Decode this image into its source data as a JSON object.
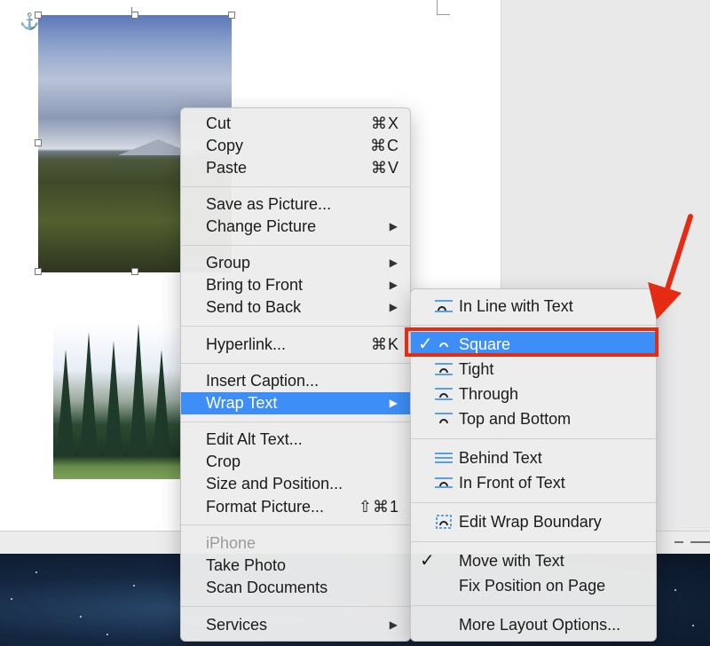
{
  "main_menu": {
    "items": [
      {
        "label": "Cut",
        "shortcut": "⌘X"
      },
      {
        "label": "Copy",
        "shortcut": "⌘C"
      },
      {
        "label": "Paste",
        "shortcut": "⌘V"
      },
      {
        "label": "Save as Picture..."
      },
      {
        "label": "Change Picture",
        "submenu": "▶"
      },
      {
        "label": "Group",
        "submenu": "▶"
      },
      {
        "label": "Bring to Front",
        "submenu": "▶"
      },
      {
        "label": "Send to Back",
        "submenu": "▶"
      },
      {
        "label": "Hyperlink...",
        "shortcut": "⌘K"
      },
      {
        "label": "Insert Caption..."
      },
      {
        "label": "Wrap Text",
        "submenu": "▶",
        "highlighted": true
      },
      {
        "label": "Edit Alt Text..."
      },
      {
        "label": "Crop"
      },
      {
        "label": "Size and Position..."
      },
      {
        "label": "Format Picture...",
        "shortcut": "⇧⌘1"
      },
      {
        "label": "iPhone",
        "disabled": true
      },
      {
        "label": "Take Photo"
      },
      {
        "label": "Scan Documents"
      },
      {
        "label": "Services",
        "submenu": "▶"
      }
    ]
  },
  "wrap_menu": {
    "items": [
      {
        "label": "In Line with Text"
      },
      {
        "label": "Square",
        "checked": true,
        "check": "✓"
      },
      {
        "label": "Tight"
      },
      {
        "label": "Through"
      },
      {
        "label": "Top and Bottom"
      },
      {
        "label": "Behind Text"
      },
      {
        "label": "In Front of Text"
      },
      {
        "label": "Edit Wrap Boundary"
      },
      {
        "label": "Move with Text",
        "checked": true,
        "check": "✓"
      },
      {
        "label": "Fix Position on Page"
      },
      {
        "label": "More Layout Options..."
      }
    ]
  },
  "icons": {
    "anchor": "⚓"
  },
  "colors": {
    "highlight": "#3d8ef7",
    "annotation": "#e52b12"
  }
}
